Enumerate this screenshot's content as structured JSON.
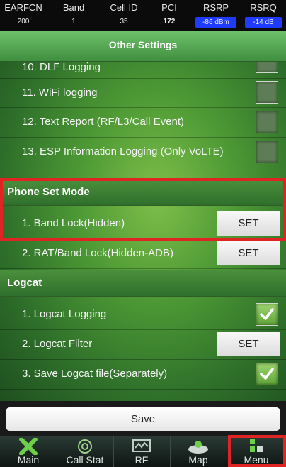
{
  "status_bar": {
    "columns": [
      {
        "label": "EARFCN",
        "value": "200"
      },
      {
        "label": "Band",
        "value": "1"
      },
      {
        "label": "Cell ID",
        "value": "35"
      },
      {
        "label": "PCI",
        "value": "172"
      },
      {
        "label": "RSRP",
        "value": "-86 dBm"
      },
      {
        "label": "RSRQ",
        "value": "-14 dB"
      }
    ]
  },
  "header": {
    "title": "Other Settings"
  },
  "settings": {
    "dlf_logging": "10. DLF Logging",
    "wifi_logging": "11. WiFi logging",
    "text_report": "12. Text Report (RF/L3/Call Event)",
    "esp_logging": "13. ESP Information Logging (Only VoLTE)"
  },
  "phone_set_mode": {
    "title": "Phone Set Mode",
    "band_lock": "1. Band Lock(Hidden)",
    "rat_band_lock": "2. RAT/Band Lock(Hidden-ADB)",
    "set_label": "SET"
  },
  "logcat": {
    "title": "Logcat",
    "logging": "1. Logcat Logging",
    "filter": "2. Logcat Filter",
    "save_file": "3. Save Logcat file(Separately)",
    "set_label": "SET"
  },
  "checkbox_states": {
    "dlf": false,
    "wifi": false,
    "text_report": false,
    "esp": false,
    "logcat_logging": true,
    "save_logcat": true
  },
  "save_button": "Save",
  "nav": {
    "items": [
      "Main",
      "Call Stat",
      "RF",
      "Map",
      "Menu"
    ],
    "active": "Menu"
  },
  "colors": {
    "highlight": "#e02424",
    "accent_blue": "#1e3bff",
    "green": "#4e9a35"
  }
}
